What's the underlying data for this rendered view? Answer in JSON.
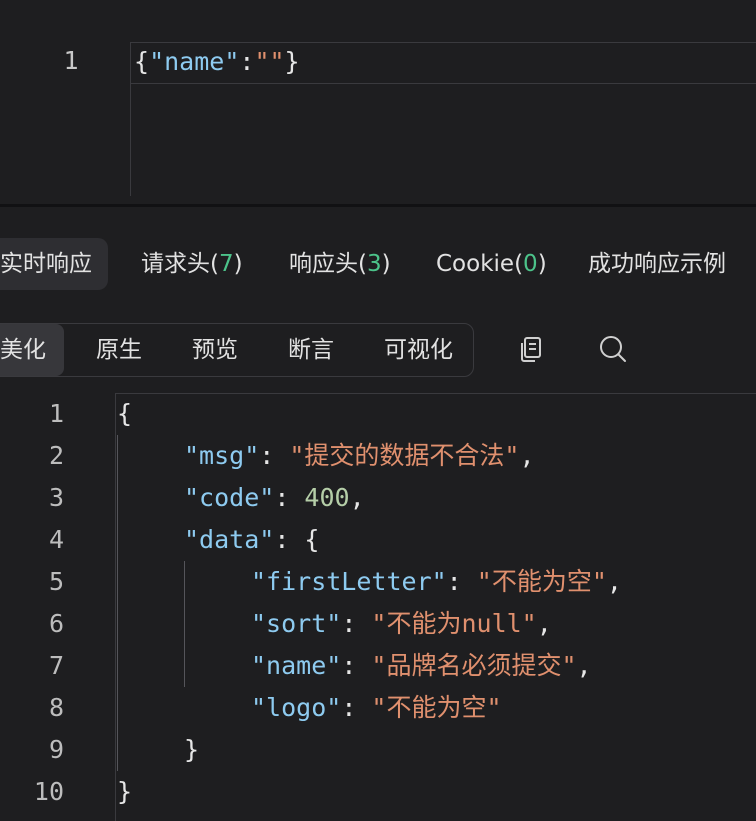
{
  "request_editor": {
    "line_number": "1",
    "tokens": {
      "open": "{",
      "key": "\"name\"",
      "colon": ":",
      "value": "\"\"",
      "close": "}"
    }
  },
  "response_tabs": [
    {
      "label": "实时响应",
      "count": ""
    },
    {
      "label": "请求头(",
      "count": "7",
      "suffix": ")"
    },
    {
      "label": "响应头(",
      "count": "3",
      "suffix": ")"
    },
    {
      "label": "Cookie(",
      "count": "0",
      "suffix": ")"
    },
    {
      "label": "成功响应示例",
      "count": ""
    }
  ],
  "view_modes": [
    "美化",
    "原生",
    "预览",
    "断言",
    "可视化"
  ],
  "toolbar_icons": [
    "copy-icon",
    "search-icon"
  ],
  "response_body": {
    "line_numbers": [
      "1",
      "2",
      "3",
      "4",
      "5",
      "6",
      "7",
      "8",
      "9",
      "10"
    ],
    "lines": [
      {
        "parts": [
          {
            "t": "{",
            "c": "brace"
          }
        ]
      },
      {
        "parts": [
          {
            "t": "\"msg\"",
            "c": "key"
          },
          {
            "t": ": ",
            "c": "brace"
          },
          {
            "t": "\"提交的数据不合法\"",
            "c": "str"
          },
          {
            "t": ",",
            "c": "brace"
          }
        ]
      },
      {
        "parts": [
          {
            "t": "\"code\"",
            "c": "key"
          },
          {
            "t": ": ",
            "c": "brace"
          },
          {
            "t": "400",
            "c": "num"
          },
          {
            "t": ",",
            "c": "brace"
          }
        ]
      },
      {
        "parts": [
          {
            "t": "\"data\"",
            "c": "key"
          },
          {
            "t": ": {",
            "c": "brace"
          }
        ]
      },
      {
        "parts": [
          {
            "t": "\"firstLetter\"",
            "c": "key"
          },
          {
            "t": ": ",
            "c": "brace"
          },
          {
            "t": "\"不能为空\"",
            "c": "str"
          },
          {
            "t": ",",
            "c": "brace"
          }
        ]
      },
      {
        "parts": [
          {
            "t": "\"sort\"",
            "c": "key"
          },
          {
            "t": ": ",
            "c": "brace"
          },
          {
            "t": "\"不能为null\"",
            "c": "str"
          },
          {
            "t": ",",
            "c": "brace"
          }
        ]
      },
      {
        "parts": [
          {
            "t": "\"name\"",
            "c": "key"
          },
          {
            "t": ": ",
            "c": "brace"
          },
          {
            "t": "\"品牌名必须提交\"",
            "c": "str"
          },
          {
            "t": ",",
            "c": "brace"
          }
        ]
      },
      {
        "parts": [
          {
            "t": "\"logo\"",
            "c": "key"
          },
          {
            "t": ": ",
            "c": "brace"
          },
          {
            "t": "\"不能为空\"",
            "c": "str"
          }
        ]
      },
      {
        "parts": [
          {
            "t": "}",
            "c": "brace"
          }
        ]
      },
      {
        "parts": [
          {
            "t": "}",
            "c": "brace"
          }
        ]
      }
    ]
  },
  "colors": {
    "key": "#8ecbf0",
    "string": "#e0906e",
    "number": "#b5cea8",
    "count": "#4cc38a"
  }
}
